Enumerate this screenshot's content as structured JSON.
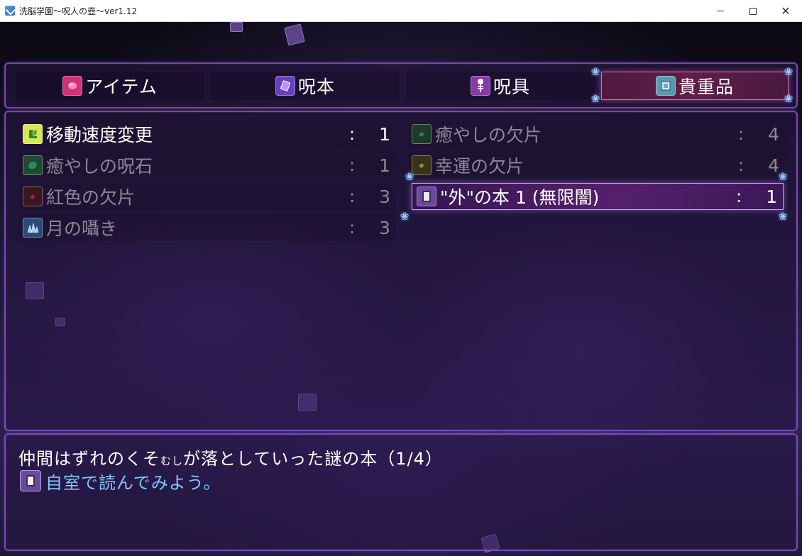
{
  "window": {
    "title": "洗脳学園～呪人の壺～ver1.12",
    "controls": {
      "minimize": "minimize",
      "maximize": "maximize",
      "close": "close"
    }
  },
  "tabs": [
    {
      "label": "アイテム",
      "icon": "gem-icon",
      "icon_color": "#d4307a",
      "selected": false
    },
    {
      "label": "呪本",
      "icon": "spellbook-icon",
      "icon_color": "#6a40c0",
      "selected": false
    },
    {
      "label": "呪具",
      "icon": "skeleton-icon",
      "icon_color": "#8a3aa8",
      "selected": false
    },
    {
      "label": "貴重品",
      "icon": "valuable-icon",
      "icon_color": "#5a9ab0",
      "selected": true
    }
  ],
  "items": {
    "left": [
      {
        "name": "移動速度変更",
        "colon": ":",
        "qty": "1",
        "icon": "boot-icon",
        "icon_color": "#d8e84a",
        "dim": false
      },
      {
        "name": "癒やしの呪石",
        "colon": ":",
        "qty": "1",
        "icon": "green-stone-icon",
        "icon_color": "#2e8a52",
        "dim": true
      },
      {
        "name": "紅色の欠片",
        "colon": ":",
        "qty": "3",
        "icon": "red-shard-icon",
        "icon_color": "#5a1a2a",
        "dim": true
      },
      {
        "name": "月の囁き",
        "colon": ":",
        "qty": "3",
        "icon": "blue-crystal-icon",
        "icon_color": "#4a8ac8",
        "dim": true
      }
    ],
    "right": [
      {
        "name": "癒やしの欠片",
        "colon": ":",
        "qty": "4",
        "icon": "green-shard-icon",
        "icon_color": "#1e3a2a",
        "dim": true
      },
      {
        "name": "幸運の欠片",
        "colon": ":",
        "qty": "4",
        "icon": "gold-shard-icon",
        "icon_color": "#3a3218",
        "dim": true
      },
      {
        "name": "\"外\"の本 1 (無限闇)",
        "colon": ":",
        "qty": "1",
        "icon": "book-icon",
        "icon_color": "#6a4aa0",
        "dim": false,
        "selected": true
      }
    ]
  },
  "description": {
    "line1_pre": "仲間はずれのくそ",
    "line1_ruby": "むし",
    "line1_post": "が落としていった謎の本（1/4）",
    "line2": "自室で読んでみよう。",
    "line2_icon": "book-icon",
    "line2_color": "#7fc8ff"
  }
}
